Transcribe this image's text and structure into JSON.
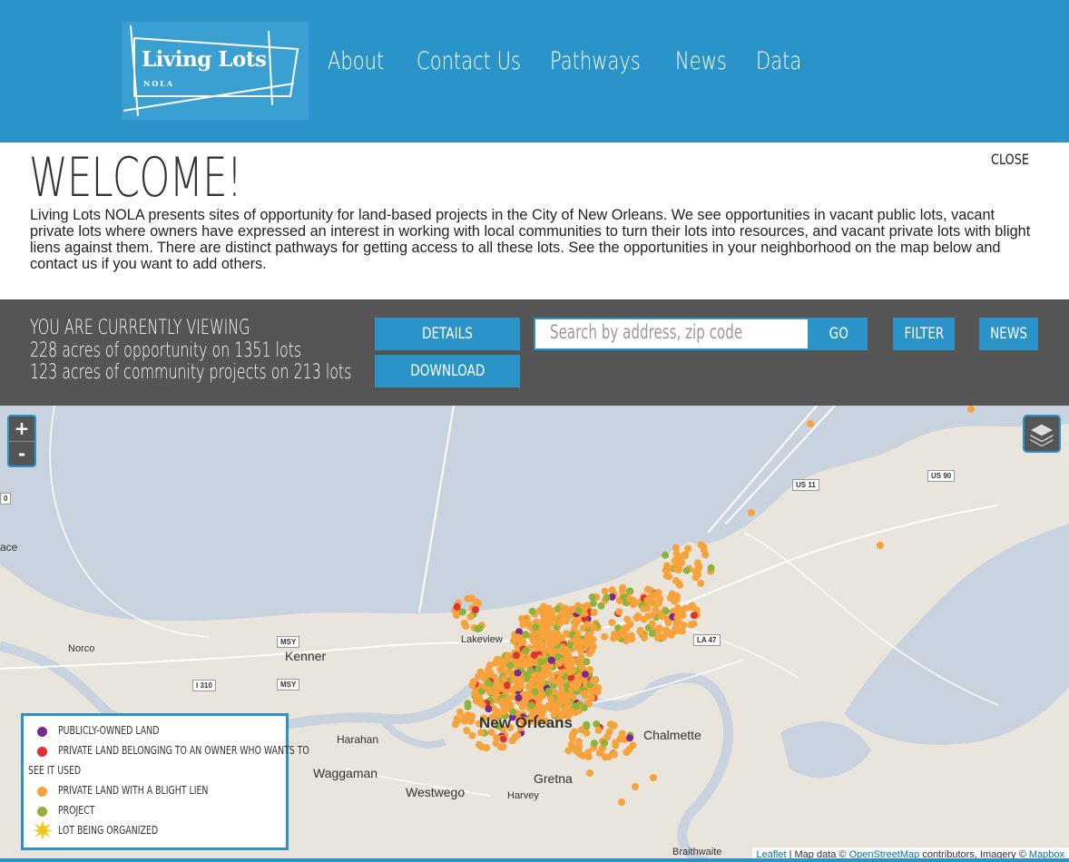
{
  "header": {
    "logo": {
      "title": "Living Lots",
      "subtitle": "NOLA"
    },
    "nav": [
      "About",
      "Contact Us",
      "Pathways",
      "News",
      "Data"
    ]
  },
  "welcome": {
    "title": "WELCOME!",
    "close_label": "CLOSE",
    "body": "Living Lots NOLA presents sites of opportunity for land-based projects in the City of New Orleans. We see opportunities in vacant public lots, vacant private lots where owners have expressed an interest in working with local communities to turn their lots into resources, and vacant private lots with blight liens against them. There are distinct pathways for getting access to all these lots. See the opportunities in your neighborhood on the map below and contact us if you want to add others."
  },
  "status": {
    "heading": "YOU ARE CURRENTLY VIEWING",
    "opportunity": "228 acres of opportunity on 1351 lots",
    "community": "123 acres of community projects on 213 lots",
    "details_label": "DETAILS",
    "download_label": "DOWNLOAD",
    "search_placeholder": "Search by address, zip code",
    "go_label": "GO",
    "filter_label": "FILTER",
    "news_label": "NEWS"
  },
  "map": {
    "zoom_in": "+",
    "zoom_out": "-",
    "places": {
      "new_orleans": "New Orleans",
      "kenner": "Kenner",
      "lakeview": "Lakeview",
      "chalmette": "Chalmette",
      "harahan": "Harahan",
      "waggaman": "Waggaman",
      "westwego": "Westwego",
      "harvey": "Harvey",
      "gretna": "Gretna",
      "norco": "Norco",
      "braithwaite": "Braithwaite",
      "ace": "ace"
    },
    "shields": [
      "MSY",
      "MSY",
      "I 310",
      "US 11",
      "US 90",
      "LA 47",
      "0"
    ],
    "colors": {
      "water": "#c9d3e0",
      "land": "#e9e5dc",
      "public": "#7b2a8c",
      "owner_wants": "#e03131",
      "blight": "#f7a23a",
      "project": "#8db33a",
      "organized": "#f5c518"
    }
  },
  "legend": {
    "public": "PUBLICLY-OWNED LAND",
    "owner_wants_line1": "PRIVATE LAND BELONGING TO AN OWNER WHO WANTS TO",
    "owner_wants_line2": "SEE IT USED",
    "blight": "PRIVATE LAND WITH A BLIGHT LIEN",
    "project": "PROJECT",
    "organized": "LOT BEING ORGANIZED"
  },
  "attribution": {
    "leaflet": "Leaflet",
    "map_data": " | Map data © ",
    "osm": "OpenStreetMap",
    "contrib": " contributors, Imagery © ",
    "mapbox": "Mapbox"
  }
}
